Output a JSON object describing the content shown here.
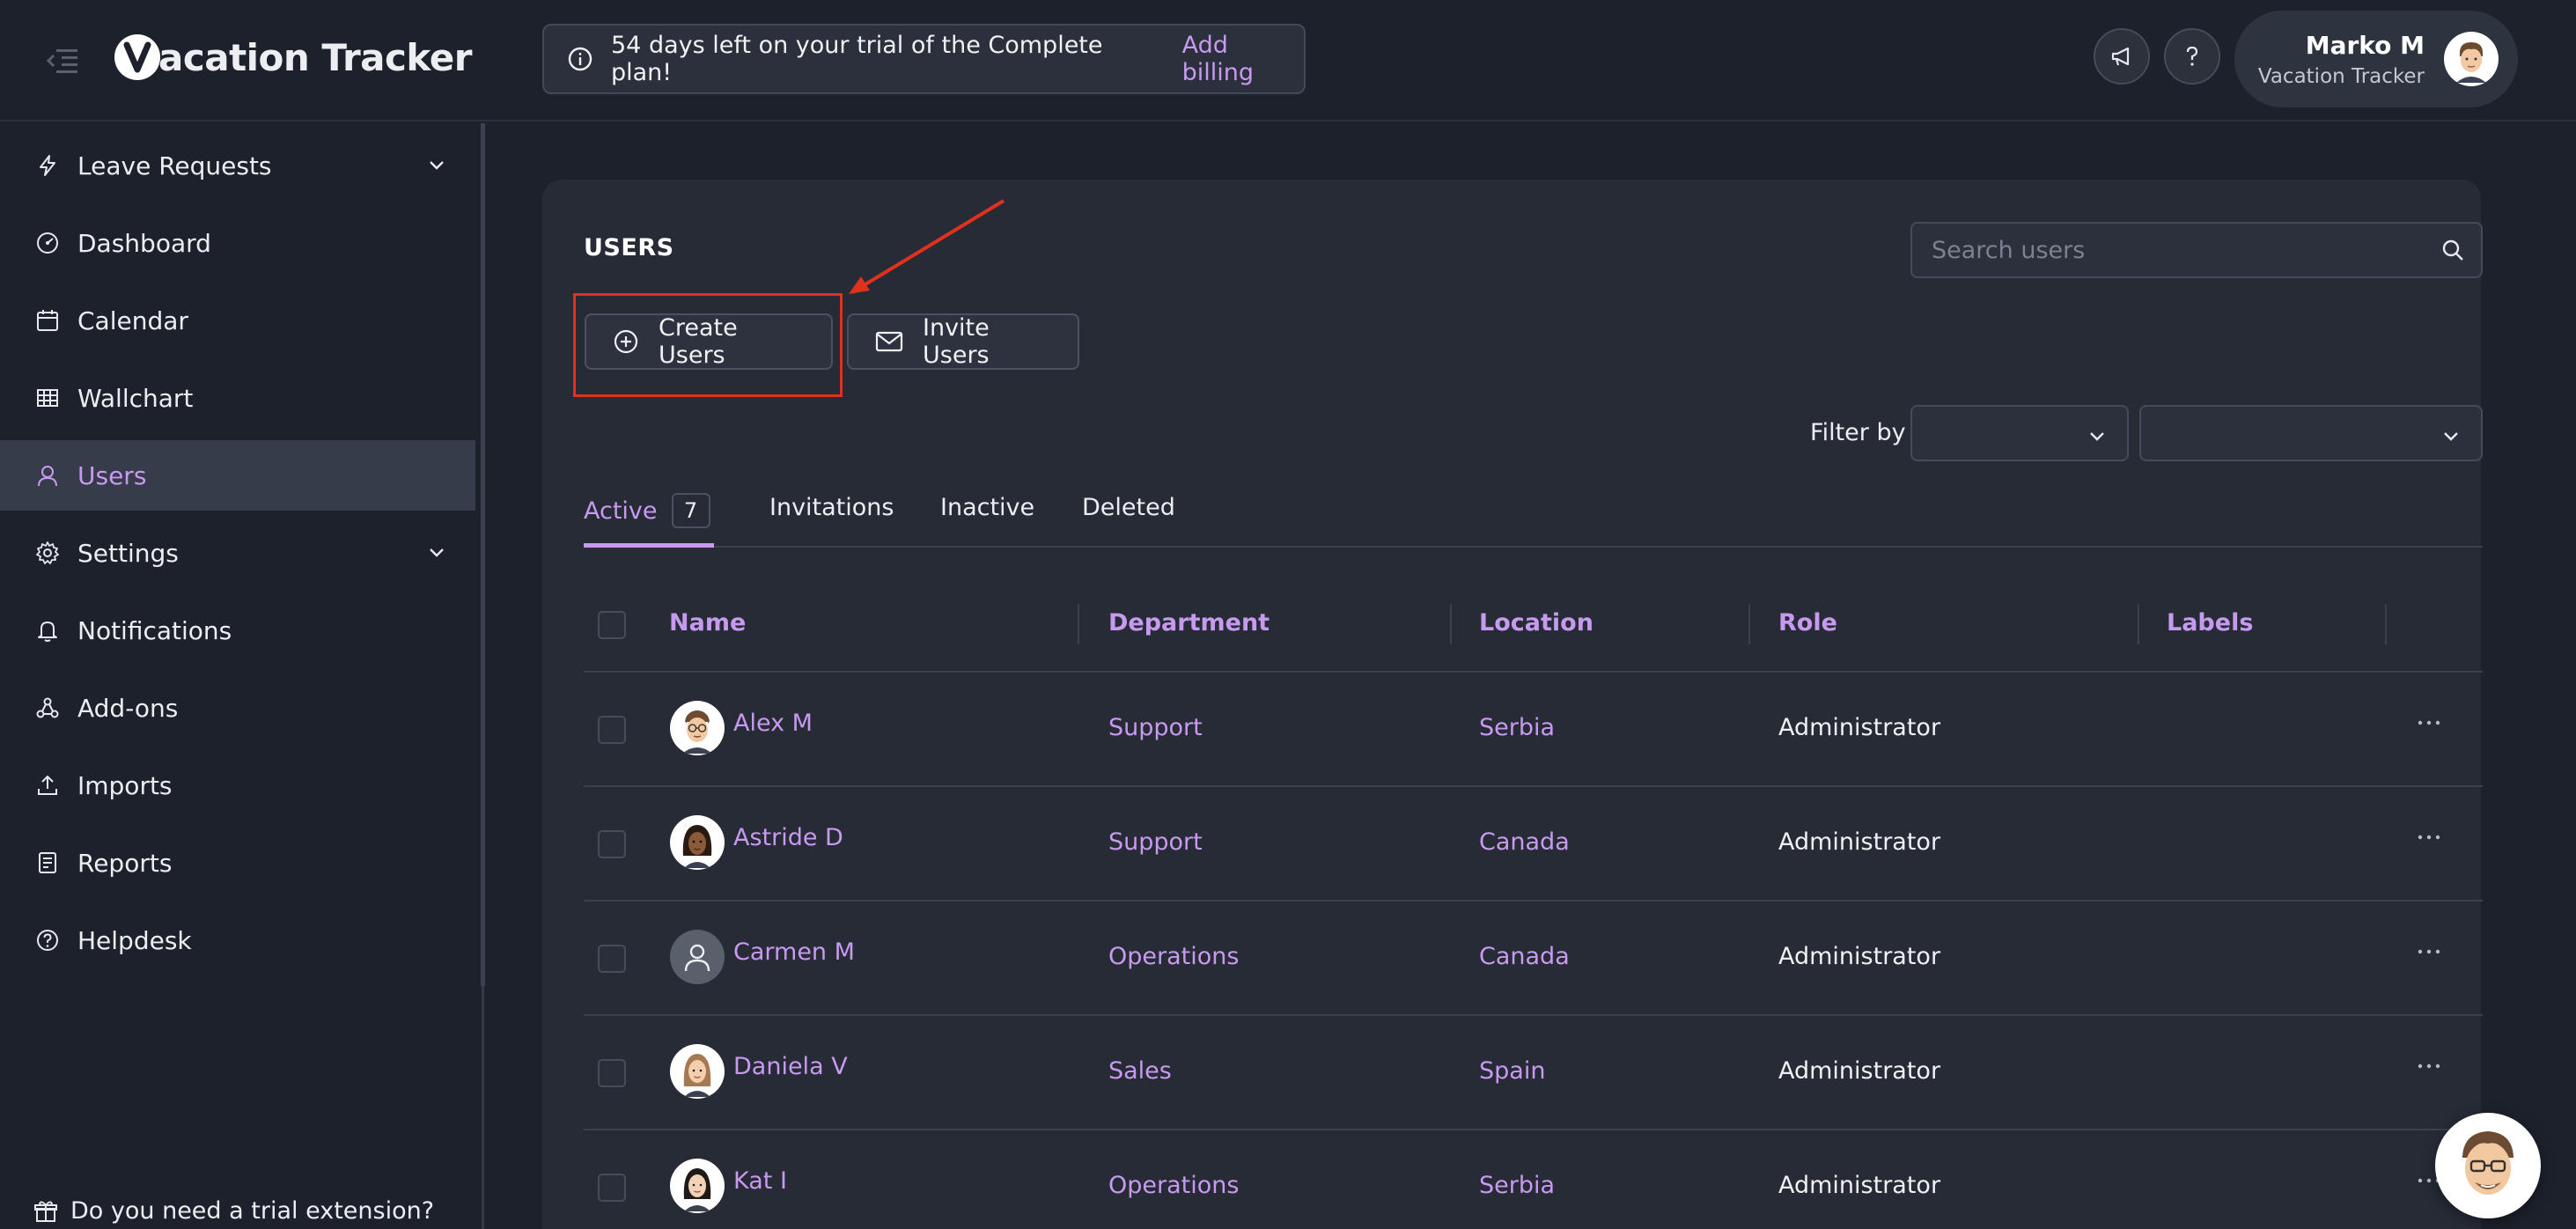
{
  "app": {
    "logo_letter": "V",
    "logo_text": "acation Tracker"
  },
  "banner": {
    "message": "54 days left on your trial of the Complete plan!",
    "link": "Add billing"
  },
  "header": {
    "user_name": "Marko M",
    "company": "Vacation Tracker",
    "icons": [
      "megaphone-icon",
      "help-icon"
    ]
  },
  "sidebar": {
    "items": [
      {
        "label": "Leave Requests",
        "icon": "lightning-icon",
        "expandable": true
      },
      {
        "label": "Dashboard",
        "icon": "dashboard-icon"
      },
      {
        "label": "Calendar",
        "icon": "calendar-icon"
      },
      {
        "label": "Wallchart",
        "icon": "grid-icon"
      },
      {
        "label": "Users",
        "icon": "user-icon",
        "active": true
      },
      {
        "label": "Settings",
        "icon": "gear-icon",
        "expandable": true
      },
      {
        "label": "Notifications",
        "icon": "bell-icon"
      },
      {
        "label": "Add-ons",
        "icon": "addons-icon"
      },
      {
        "label": "Imports",
        "icon": "upload-icon"
      },
      {
        "label": "Reports",
        "icon": "report-icon"
      },
      {
        "label": "Helpdesk",
        "icon": "helpdesk-icon"
      }
    ],
    "trial_extension": "Do you need a trial extension?"
  },
  "main": {
    "title": "USERS",
    "search_placeholder": "Search users",
    "buttons": {
      "create": "Create Users",
      "invite": "Invite Users"
    },
    "filter_label": "Filter by",
    "tabs": [
      {
        "label": "Active",
        "count": "7",
        "active": true
      },
      {
        "label": "Invitations"
      },
      {
        "label": "Inactive"
      },
      {
        "label": "Deleted"
      }
    ],
    "columns": [
      "Name",
      "Department",
      "Location",
      "Role",
      "Labels"
    ],
    "rows": [
      {
        "name": "Alex M",
        "department": "Support",
        "location": "Serbia",
        "role": "Administrator"
      },
      {
        "name": "Astride D",
        "department": "Support",
        "location": "Canada",
        "role": "Administrator"
      },
      {
        "name": "Carmen M",
        "department": "Operations",
        "location": "Canada",
        "role": "Administrator"
      },
      {
        "name": "Daniela V",
        "department": "Sales",
        "location": "Spain",
        "role": "Administrator"
      },
      {
        "name": "Kat I",
        "department": "Operations",
        "location": "Serbia",
        "role": "Administrator"
      }
    ]
  },
  "colors": {
    "accent": "#c79af0",
    "highlight": "#e0301e",
    "background": "#1d212b",
    "card": "#272b36"
  }
}
